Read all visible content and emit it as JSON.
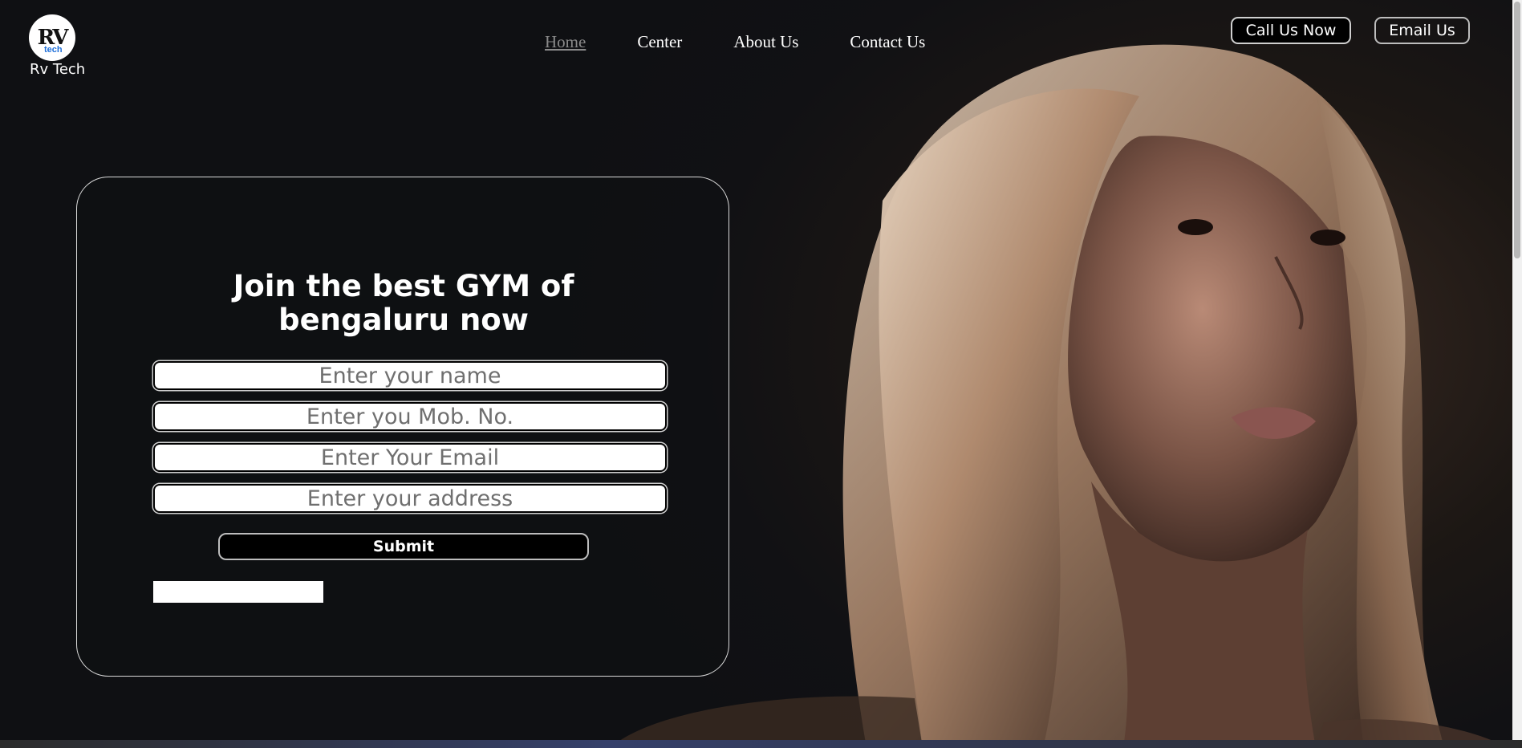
{
  "brand": {
    "name": "Rv Tech",
    "logo_mark": "RV",
    "logo_sub": "tech"
  },
  "nav": {
    "items": [
      {
        "label": "Home",
        "active": true
      },
      {
        "label": "Center"
      },
      {
        "label": "About Us"
      },
      {
        "label": "Contact Us"
      }
    ]
  },
  "actions": {
    "call_label": "Call Us Now",
    "email_label": "Email Us"
  },
  "form": {
    "heading": "Join the best GYM of bengaluru now",
    "name_placeholder": "Enter your name",
    "mobile_placeholder": "Enter you Mob. No.",
    "email_placeholder": "Enter Your Email",
    "address_placeholder": "Enter your address",
    "submit_label": "Submit"
  },
  "colors": {
    "background": "#0f1013",
    "accent": "#ffffff",
    "nav_active": "#8a8a8a"
  }
}
